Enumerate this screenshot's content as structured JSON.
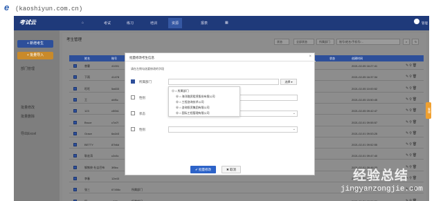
{
  "site": {
    "logo": "e",
    "url": "(kaoshiyun.com.cn)"
  },
  "app": {
    "brand": "考试云",
    "nav": [
      "考试",
      "练习",
      "培训",
      "资源",
      "报表"
    ],
    "active_nav": "资源",
    "user_label": "管理"
  },
  "sidebar": {
    "buttons": [
      "+ 新增考生",
      "+ 批量导入"
    ],
    "links": [
      "部门管理",
      "批量修改",
      "批量删除",
      "导出Excel"
    ]
  },
  "main": {
    "title": "考生管理",
    "filters": [
      "状态",
      "全部状态",
      "所属部门"
    ],
    "search_placeholder": "账号/姓名/手机号/…",
    "columns": [
      "姓名",
      "账号",
      "状态",
      "创建时间"
    ],
    "rows": [
      {
        "name": "曾曹",
        "account": "41001",
        "time": "2021-02-05 16:27:41"
      },
      {
        "name": "下雨",
        "account": "41478",
        "time": "2021-02-05 16:37:34"
      },
      {
        "name": "旺旺",
        "account": "5a633",
        "time": "2021-02-05 10:00:52"
      },
      {
        "name": "王",
        "account": "d4f5c",
        "time": "2021-02-05 15:50:45"
      },
      {
        "name": "123",
        "account": "c50b1",
        "time": "2021-02-05 09:42:47"
      },
      {
        "name": "Bruce",
        "account": "c7a7f",
        "time": "2021-02-01 09:55:57"
      },
      {
        "name": "Grace",
        "account": "6a1b3",
        "time": "2021-02-01 09:53:25"
      },
      {
        "name": "BETTY",
        "account": "87b6d",
        "time": "2021-02-01 09:52:55"
      },
      {
        "name": "耿宏涛",
        "account": "c2c5c",
        "time": "2021-02-01 09:47:40"
      },
      {
        "name": "钢铁侠·杜吉巴布",
        "account": "3f5bc",
        "time": "2021-02-01 09:46:33"
      },
      {
        "name": "李春",
        "account": "12e43",
        "time": "2021-01-31 13:11:56"
      },
      {
        "name": "张三",
        "account": "67456c",
        "dept": "所属部门",
        "time": "2021-01-31 13:10:03"
      },
      {
        "name": "阿",
        "account": "a223c",
        "dept": "所属部门",
        "time": "2021-01-31 13:09:30"
      }
    ]
  },
  "modal": {
    "title": "批量修改考生信息",
    "close": "×",
    "hint": "请在左侧勾选要修改的字段",
    "fields": [
      "所属部门",
      "性别",
      "状态",
      "性别"
    ],
    "select_btn": "选择 ▾",
    "tree": {
      "root": "所属部门",
      "children": [
        "海洋融资租赁股份有限公司",
        "工程咨询技术公司",
        "咨询投资集团有限公司",
        "国际工程管理有限公司"
      ]
    },
    "ok": "✔ 批量修改",
    "cancel": "✖ 取消"
  },
  "side_tab": "客服",
  "watermark": {
    "text": "经验总结",
    "url": "jingyanzongjie.com"
  }
}
